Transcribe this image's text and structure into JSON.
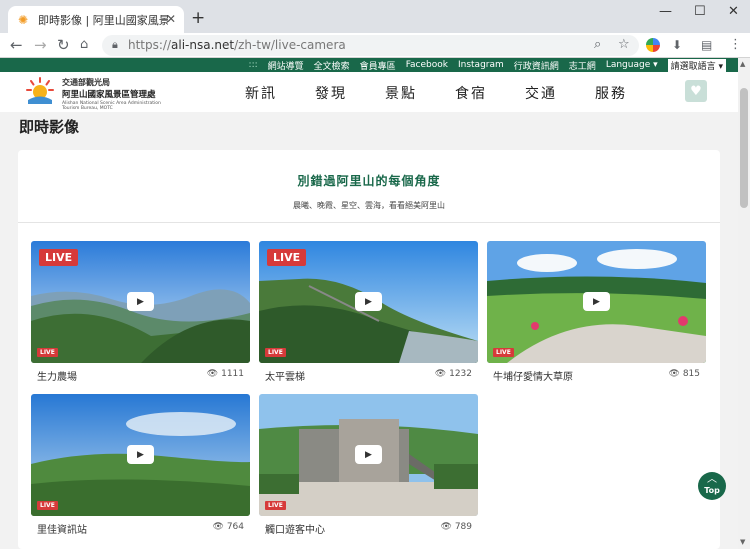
{
  "browser": {
    "tab_title": "即時影像 | 阿里山國家風景區",
    "url_host": "ali-nsa.net",
    "url_path": "/zh-tw/live-camera",
    "url_scheme": "https://"
  },
  "topbar": {
    "dots": ":::",
    "links": [
      "網站導覽",
      "全文檢索",
      "會員專區",
      "Facebook",
      "Instagram",
      "行政資訊網",
      "志工網",
      "Language ▾",
      "請選取語言 ▾"
    ]
  },
  "logo": {
    "line1": "交通部觀光局",
    "line2": "阿里山國家風景區管理處",
    "line3": "Alishan National Scenic Area Administration",
    "line4": "Tourism Bureau, MOTC"
  },
  "nav": [
    "新訊",
    "發現",
    "景點",
    "食宿",
    "交通",
    "服務"
  ],
  "page": {
    "title": "即時影像",
    "card_title": "別錯過阿里山的每個角度",
    "card_subtitle": "晨曦、晚霞、星空、雲海，看看絕美阿里山"
  },
  "live_badge": "LIVE",
  "cameras": [
    {
      "name": "生力農場",
      "views": "1111"
    },
    {
      "name": "太平雲梯",
      "views": "1232"
    },
    {
      "name": "牛埔仔愛情大草原",
      "views": "815"
    },
    {
      "name": "里佳資訊站",
      "views": "764"
    },
    {
      "name": "觸口遊客中心",
      "views": "789"
    }
  ],
  "top_button": "Top",
  "colors": {
    "brand_green": "#19684a",
    "live_red": "#d63a3a"
  }
}
